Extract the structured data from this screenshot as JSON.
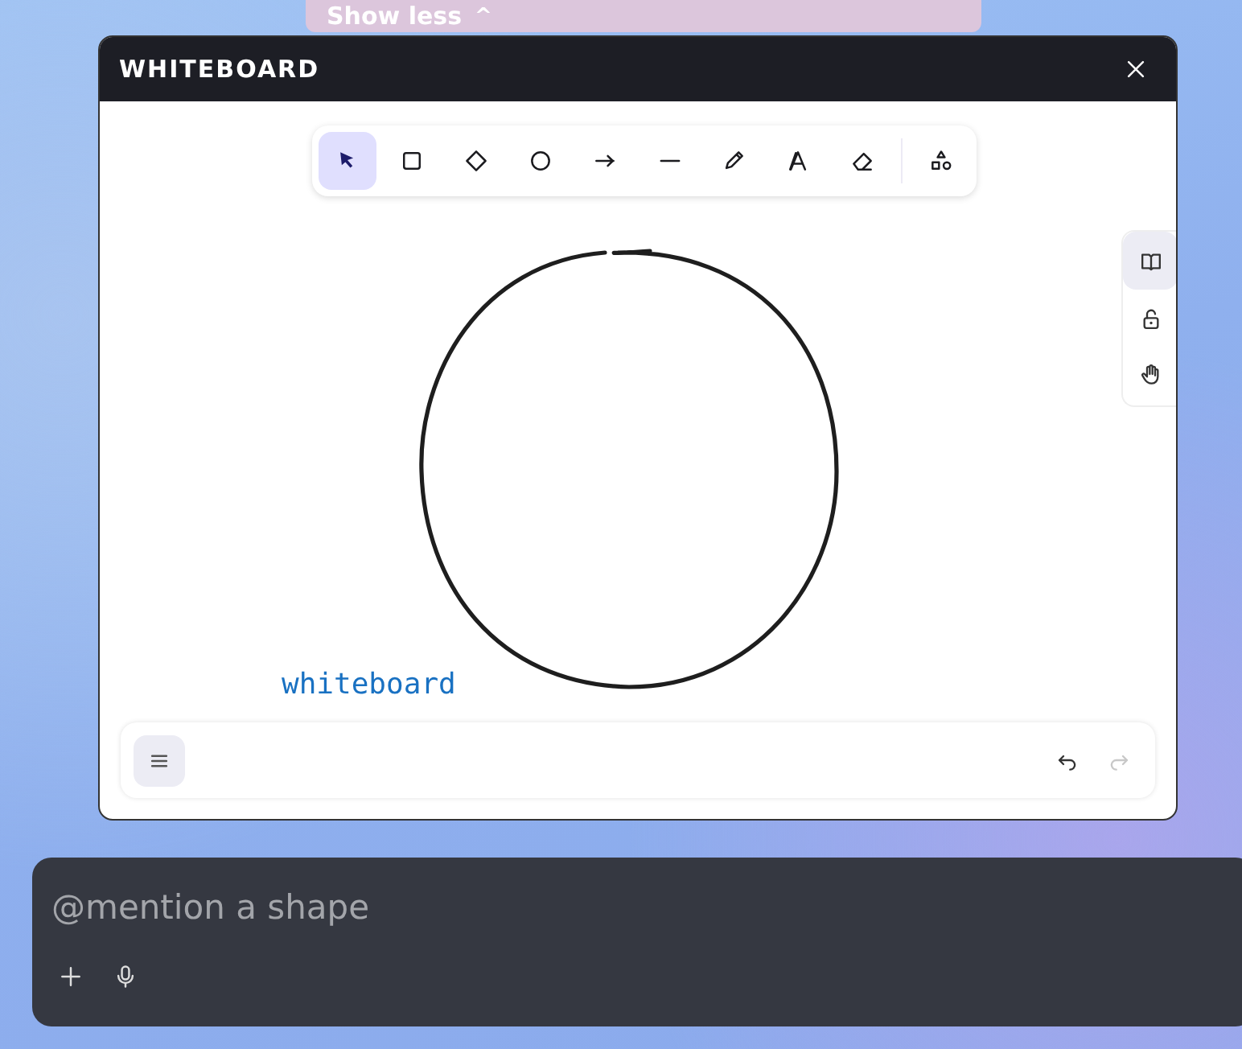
{
  "banner": {
    "label": "Show less",
    "icon": "^"
  },
  "window": {
    "title": "WHITEBOARD"
  },
  "toolbar": [
    {
      "kind": "select",
      "selected": true
    },
    {
      "kind": "rectangle",
      "selected": false
    },
    {
      "kind": "diamond",
      "selected": false
    },
    {
      "kind": "ellipse",
      "selected": false
    },
    {
      "kind": "arrow",
      "selected": false
    },
    {
      "kind": "line",
      "selected": false
    },
    {
      "kind": "draw",
      "selected": false
    },
    {
      "kind": "text",
      "selected": false
    },
    {
      "kind": "eraser",
      "selected": false
    },
    {
      "kind": "shapes",
      "selected": false
    }
  ],
  "side_tools": [
    {
      "kind": "book",
      "selected": true
    },
    {
      "kind": "lock",
      "selected": false
    },
    {
      "kind": "hand",
      "selected": false
    }
  ],
  "canvas": {
    "label": "whiteboard"
  },
  "bottom_bar": {
    "undo": {
      "disabled": false
    },
    "redo": {
      "disabled": true
    }
  },
  "chat_input": {
    "placeholder": "@mention a shape"
  }
}
